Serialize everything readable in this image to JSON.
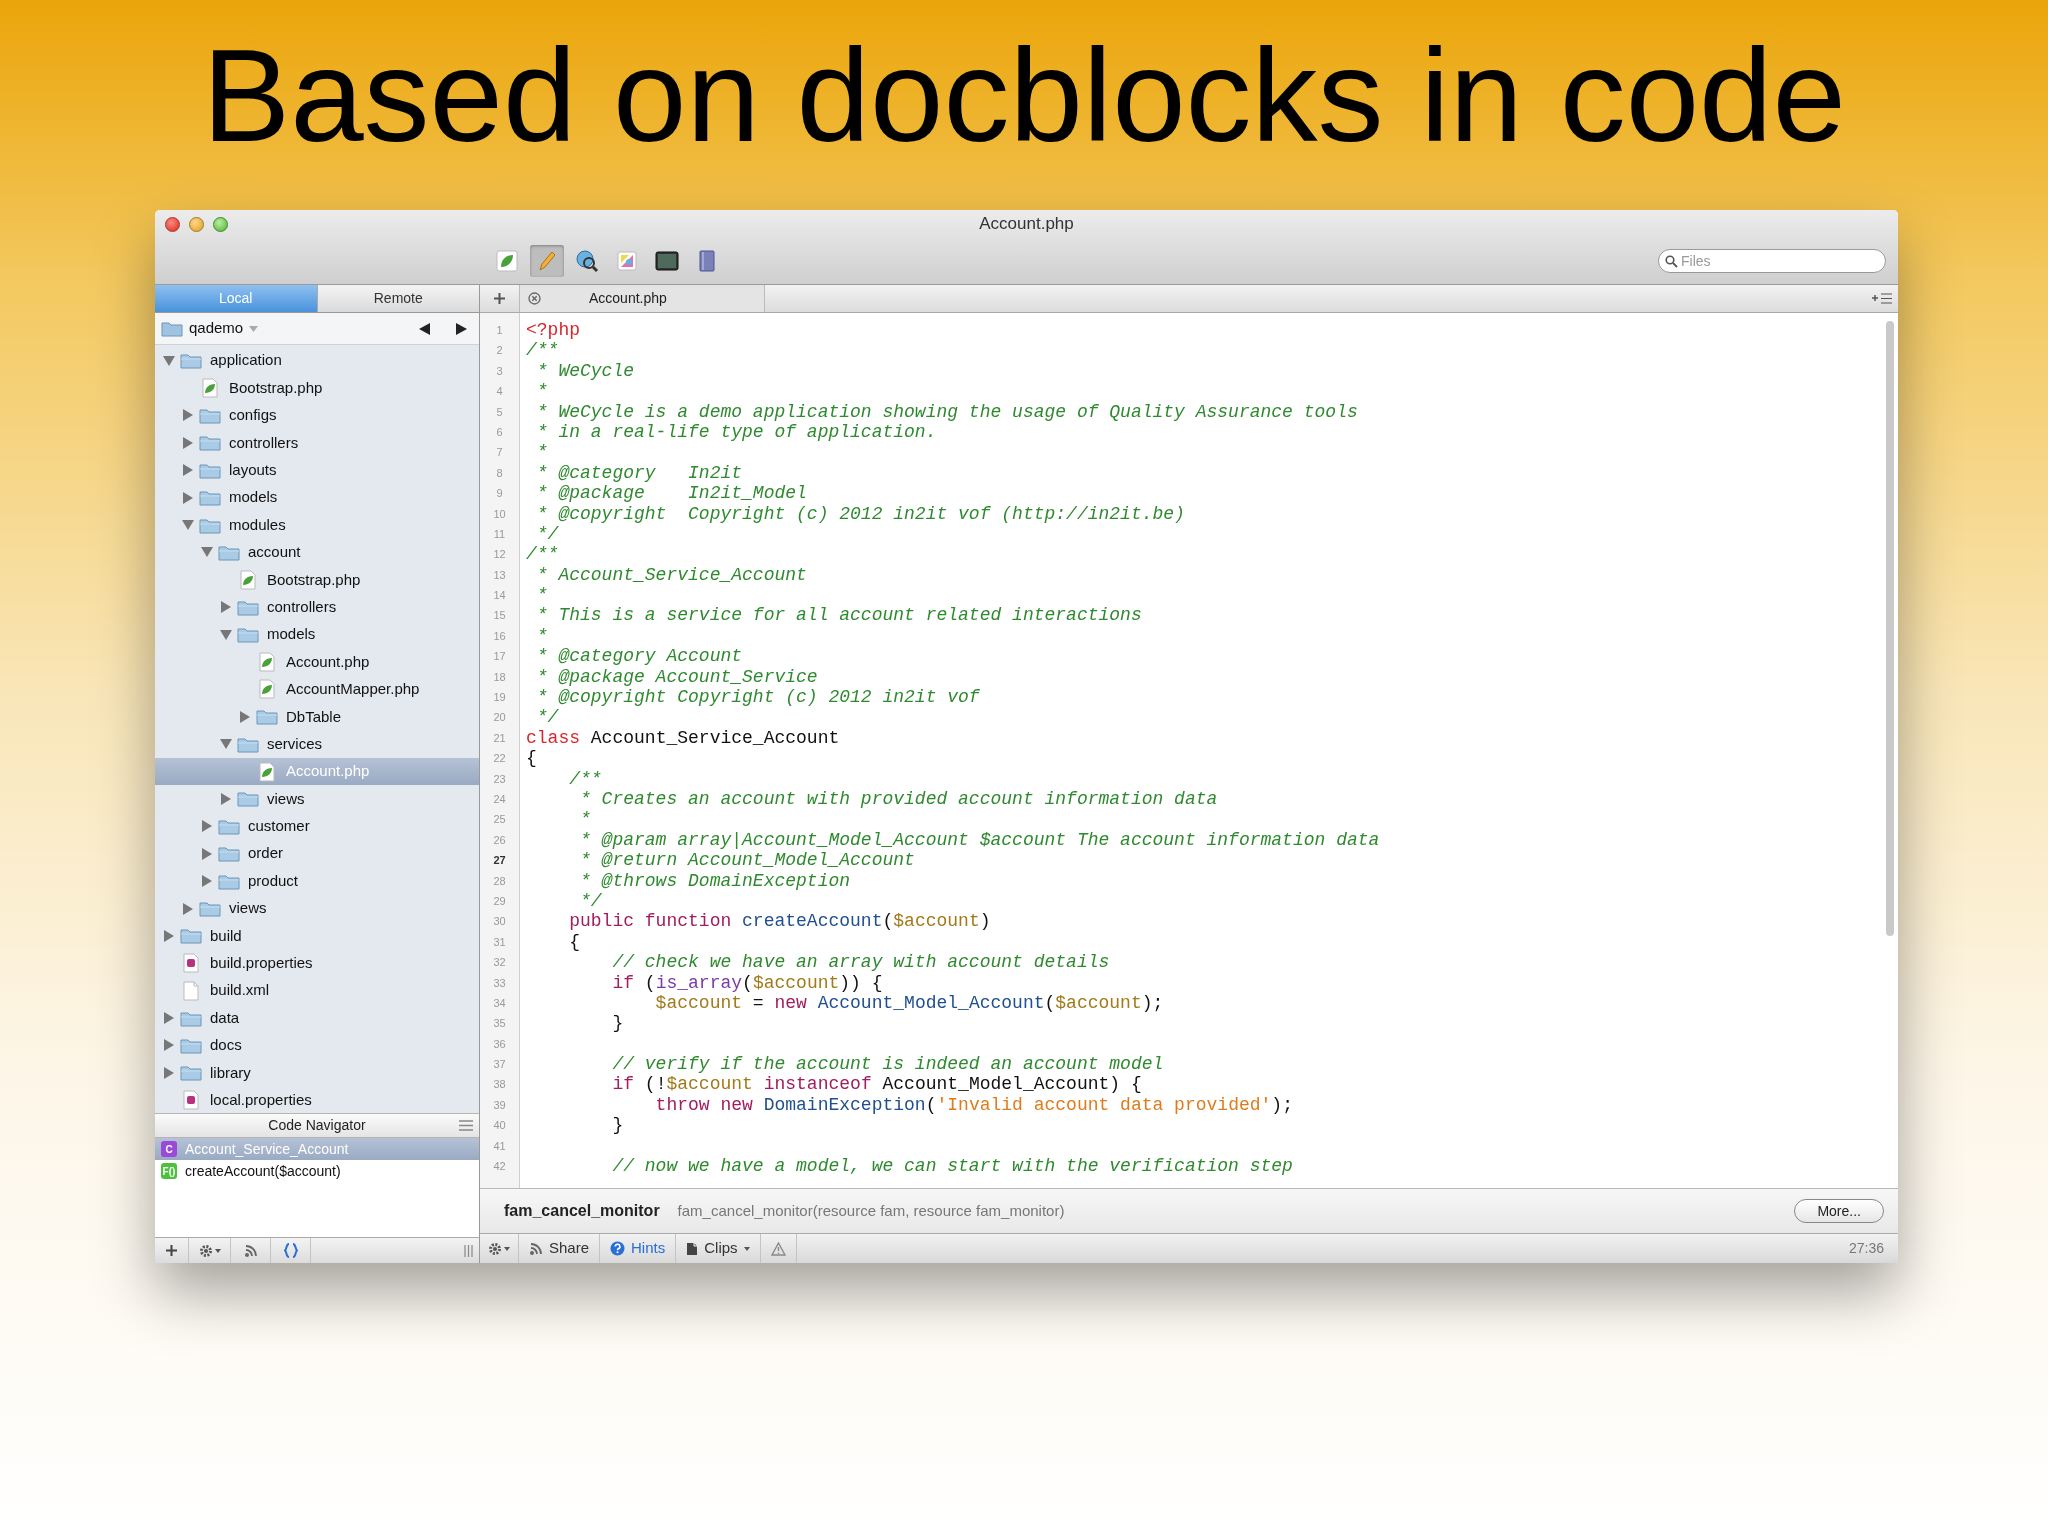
{
  "slide": {
    "title": "Based on docblocks in code"
  },
  "window": {
    "title": "Account.php"
  },
  "toolbar": [
    {
      "kind": "leaf",
      "selected": false
    },
    {
      "kind": "pencil",
      "selected": true
    },
    {
      "kind": "globe",
      "selected": false
    },
    {
      "kind": "palette",
      "selected": false
    },
    {
      "kind": "terminal",
      "selected": false
    },
    {
      "kind": "book",
      "selected": false
    }
  ],
  "search": {
    "placeholder": "Files"
  },
  "sidebar": {
    "tabs": [
      {
        "label": "Local",
        "selected": true
      },
      {
        "label": "Remote",
        "selected": false
      }
    ],
    "path": "qademo",
    "tree": [
      {
        "name": "application",
        "kind": "folder",
        "expanded": true,
        "selected": false,
        "children": [
          {
            "name": "Bootstrap.php",
            "kind": "php",
            "selected": false
          },
          {
            "name": "configs",
            "kind": "folder",
            "expanded": false,
            "selected": false
          },
          {
            "name": "controllers",
            "kind": "folder",
            "expanded": false,
            "selected": false
          },
          {
            "name": "layouts",
            "kind": "folder",
            "expanded": false,
            "selected": false
          },
          {
            "name": "models",
            "kind": "folder",
            "expanded": false,
            "selected": false
          },
          {
            "name": "modules",
            "kind": "folder",
            "expanded": true,
            "selected": false,
            "children": [
              {
                "name": "account",
                "kind": "folder",
                "expanded": true,
                "selected": false,
                "children": [
                  {
                    "name": "Bootstrap.php",
                    "kind": "php",
                    "selected": false
                  },
                  {
                    "name": "controllers",
                    "kind": "folder",
                    "expanded": false,
                    "selected": false
                  },
                  {
                    "name": "models",
                    "kind": "folder",
                    "expanded": true,
                    "selected": false,
                    "children": [
                      {
                        "name": "Account.php",
                        "kind": "php",
                        "selected": false
                      },
                      {
                        "name": "AccountMapper.php",
                        "kind": "php",
                        "selected": false
                      },
                      {
                        "name": "DbTable",
                        "kind": "folder",
                        "expanded": false,
                        "selected": false
                      }
                    ]
                  },
                  {
                    "name": "services",
                    "kind": "folder",
                    "expanded": true,
                    "selected": false,
                    "children": [
                      {
                        "name": "Account.php",
                        "kind": "php",
                        "selected": true
                      }
                    ]
                  },
                  {
                    "name": "views",
                    "kind": "folder",
                    "expanded": false,
                    "selected": false
                  }
                ]
              },
              {
                "name": "customer",
                "kind": "folder",
                "expanded": false,
                "selected": false
              },
              {
                "name": "order",
                "kind": "folder",
                "expanded": false,
                "selected": false
              },
              {
                "name": "product",
                "kind": "folder",
                "expanded": false,
                "selected": false
              }
            ]
          },
          {
            "name": "views",
            "kind": "folder",
            "expanded": false,
            "selected": false
          }
        ]
      },
      {
        "name": "build",
        "kind": "folder",
        "expanded": false,
        "selected": false
      },
      {
        "name": "build.properties",
        "kind": "props",
        "selected": false
      },
      {
        "name": "build.xml",
        "kind": "xml",
        "selected": false
      },
      {
        "name": "data",
        "kind": "folder",
        "expanded": false,
        "selected": false
      },
      {
        "name": "docs",
        "kind": "folder",
        "expanded": false,
        "selected": false
      },
      {
        "name": "library",
        "kind": "folder",
        "expanded": false,
        "selected": false
      },
      {
        "name": "local.properties",
        "kind": "props",
        "selected": false
      }
    ],
    "navigator": {
      "title": "Code Navigator",
      "items": [
        {
          "kind": "class",
          "badge": "C",
          "label": "Account_Service_Account",
          "selected": true
        },
        {
          "kind": "function",
          "badge": "F()",
          "label": "createAccount($account)",
          "selected": false
        }
      ]
    }
  },
  "editor": {
    "tab": {
      "label": "Account.php"
    },
    "lines": [
      {
        "number": "1",
        "current": false,
        "tokens": [
          {
            "kind": "tag",
            "text": "<?php"
          }
        ]
      },
      {
        "number": "2",
        "current": false,
        "tokens": [
          {
            "kind": "comment",
            "text": "/**"
          }
        ]
      },
      {
        "number": "3",
        "current": false,
        "tokens": [
          {
            "kind": "comment",
            "text": " * WeCycle"
          }
        ]
      },
      {
        "number": "4",
        "current": false,
        "tokens": [
          {
            "kind": "comment",
            "text": " *"
          }
        ]
      },
      {
        "number": "5",
        "current": false,
        "tokens": [
          {
            "kind": "comment",
            "text": " * WeCycle is a demo application showing the usage of Quality Assurance tools"
          }
        ]
      },
      {
        "number": "6",
        "current": false,
        "tokens": [
          {
            "kind": "comment",
            "text": " * in a real-life type of application."
          }
        ]
      },
      {
        "number": "7",
        "current": false,
        "tokens": [
          {
            "kind": "comment",
            "text": " *"
          }
        ]
      },
      {
        "number": "8",
        "current": false,
        "tokens": [
          {
            "kind": "comment",
            "text": " * @category   In2it"
          }
        ]
      },
      {
        "number": "9",
        "current": false,
        "tokens": [
          {
            "kind": "comment",
            "text": " * @package    In2it_Model"
          }
        ]
      },
      {
        "number": "10",
        "current": false,
        "tokens": [
          {
            "kind": "comment",
            "text": " * @copyright  Copyright (c) 2012 in2it vof (http://in2it.be)"
          }
        ]
      },
      {
        "number": "11",
        "current": false,
        "tokens": [
          {
            "kind": "comment",
            "text": " */"
          }
        ]
      },
      {
        "number": "12",
        "current": false,
        "tokens": [
          {
            "kind": "comment",
            "text": "/**"
          }
        ]
      },
      {
        "number": "13",
        "current": false,
        "tokens": [
          {
            "kind": "comment",
            "text": " * Account_Service_Account"
          }
        ]
      },
      {
        "number": "14",
        "current": false,
        "tokens": [
          {
            "kind": "comment",
            "text": " *"
          }
        ]
      },
      {
        "number": "15",
        "current": false,
        "tokens": [
          {
            "kind": "comment",
            "text": " * This is a service for all account related interactions"
          }
        ]
      },
      {
        "number": "16",
        "current": false,
        "tokens": [
          {
            "kind": "comment",
            "text": " *"
          }
        ]
      },
      {
        "number": "17",
        "current": false,
        "tokens": [
          {
            "kind": "comment",
            "text": " * @category Account"
          }
        ]
      },
      {
        "number": "18",
        "current": false,
        "tokens": [
          {
            "kind": "comment",
            "text": " * @package Account_Service"
          }
        ]
      },
      {
        "number": "19",
        "current": false,
        "tokens": [
          {
            "kind": "comment",
            "text": " * @copyright Copyright (c) 2012 in2it vof"
          }
        ]
      },
      {
        "number": "20",
        "current": false,
        "tokens": [
          {
            "kind": "comment",
            "text": " */"
          }
        ]
      },
      {
        "number": "21",
        "current": false,
        "tokens": [
          {
            "kind": "tag",
            "text": "class"
          },
          {
            "kind": "plain",
            "text": " Account_Service_Account"
          }
        ]
      },
      {
        "number": "22",
        "current": false,
        "tokens": [
          {
            "kind": "plain",
            "text": "{"
          }
        ]
      },
      {
        "number": "23",
        "current": false,
        "tokens": [
          {
            "kind": "comment",
            "text": "    /**"
          }
        ]
      },
      {
        "number": "24",
        "current": false,
        "tokens": [
          {
            "kind": "comment",
            "text": "     * Creates an account with provided account information data"
          }
        ]
      },
      {
        "number": "25",
        "current": false,
        "tokens": [
          {
            "kind": "comment",
            "text": "     *"
          }
        ]
      },
      {
        "number": "26",
        "current": false,
        "tokens": [
          {
            "kind": "comment",
            "text": "     * @param array|Account_Model_Account $account The account information data"
          }
        ]
      },
      {
        "number": "27",
        "current": true,
        "tokens": [
          {
            "kind": "comment",
            "text": "     * @return Account_Model_Account"
          }
        ]
      },
      {
        "number": "28",
        "current": false,
        "tokens": [
          {
            "kind": "comment",
            "text": "     * @throws DomainException"
          }
        ]
      },
      {
        "number": "29",
        "current": false,
        "tokens": [
          {
            "kind": "comment",
            "text": "     */"
          }
        ]
      },
      {
        "number": "30",
        "current": false,
        "tokens": [
          {
            "kind": "keyword",
            "text": "    public function"
          },
          {
            "kind": "function",
            "text": " createAccount"
          },
          {
            "kind": "plain",
            "text": "("
          },
          {
            "kind": "variable",
            "text": "$account"
          },
          {
            "kind": "plain",
            "text": ")"
          }
        ]
      },
      {
        "number": "31",
        "current": false,
        "tokens": [
          {
            "kind": "plain",
            "text": "    {"
          }
        ]
      },
      {
        "number": "32",
        "current": false,
        "tokens": [
          {
            "kind": "comment",
            "text": "        // check we have an array with account details"
          }
        ]
      },
      {
        "number": "33",
        "current": false,
        "tokens": [
          {
            "kind": "keyword",
            "text": "        if"
          },
          {
            "kind": "plain",
            "text": " ("
          },
          {
            "kind": "builtin",
            "text": "is_array"
          },
          {
            "kind": "plain",
            "text": "("
          },
          {
            "kind": "variable",
            "text": "$account"
          },
          {
            "kind": "plain",
            "text": ")) {"
          }
        ]
      },
      {
        "number": "34",
        "current": false,
        "tokens": [
          {
            "kind": "variable",
            "text": "            $account"
          },
          {
            "kind": "plain",
            "text": " = "
          },
          {
            "kind": "keyword",
            "text": "new"
          },
          {
            "kind": "function",
            "text": " Account_Model_Account"
          },
          {
            "kind": "plain",
            "text": "("
          },
          {
            "kind": "variable",
            "text": "$account"
          },
          {
            "kind": "plain",
            "text": ");"
          }
        ]
      },
      {
        "number": "35",
        "current": false,
        "tokens": [
          {
            "kind": "plain",
            "text": "        }"
          }
        ]
      },
      {
        "number": "36",
        "current": false
      },
      {
        "number": "37",
        "current": false,
        "tokens": [
          {
            "kind": "comment",
            "text": "        // verify if the account is indeed an account model"
          }
        ]
      },
      {
        "number": "38",
        "current": false,
        "tokens": [
          {
            "kind": "keyword",
            "text": "        if"
          },
          {
            "kind": "plain",
            "text": " (!"
          },
          {
            "kind": "variable",
            "text": "$account"
          },
          {
            "kind": "keyword",
            "text": " instanceof"
          },
          {
            "kind": "plain",
            "text": " Account_Model_Account) {"
          }
        ]
      },
      {
        "number": "39",
        "current": false,
        "tokens": [
          {
            "kind": "keyword",
            "text": "            throw new"
          },
          {
            "kind": "function",
            "text": " DomainException"
          },
          {
            "kind": "plain",
            "text": "("
          },
          {
            "kind": "string",
            "text": "'Invalid account data provided'"
          },
          {
            "kind": "plain",
            "text": ");"
          }
        ]
      },
      {
        "number": "40",
        "current": false,
        "tokens": [
          {
            "kind": "plain",
            "text": "        }"
          }
        ]
      },
      {
        "number": "41",
        "current": false
      },
      {
        "number": "42",
        "current": false,
        "tokens": [
          {
            "kind": "comment",
            "text": "        // now we have a model, we can start with the verification step"
          }
        ]
      }
    ],
    "hint": {
      "name": "fam_cancel_monitor",
      "signature": "fam_cancel_monitor(resource fam, resource fam_monitor)",
      "button": "More..."
    }
  },
  "status_bar": {
    "share": "Share",
    "hints": {
      "label": "Hints",
      "active": true
    },
    "clips": "Clips",
    "time": "27:36"
  }
}
